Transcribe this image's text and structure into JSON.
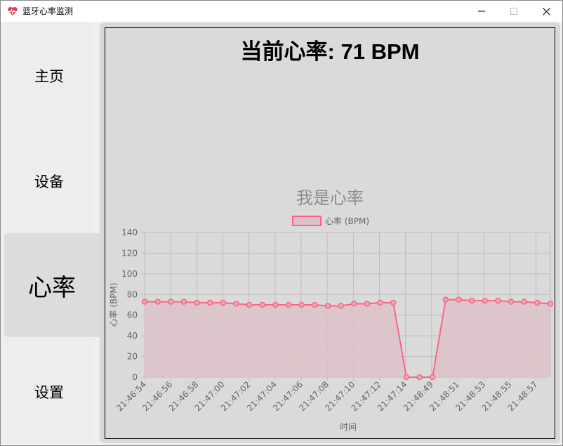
{
  "window": {
    "title": "蓝牙心率监测"
  },
  "sidebar": {
    "items": [
      {
        "label": "主页",
        "active": false
      },
      {
        "label": "设备",
        "active": false
      },
      {
        "label": "心率",
        "active": true
      },
      {
        "label": "设置",
        "active": false
      }
    ]
  },
  "main": {
    "heading_prefix": "当前心率: ",
    "heading_value": "71",
    "heading_unit": " BPM"
  },
  "chart_data": {
    "type": "area",
    "title": "我是心率",
    "xlabel": "时间",
    "ylabel": "心率 (BPM)",
    "legend": [
      "心率 (BPM)"
    ],
    "legend_position": "top",
    "grid": true,
    "ylim": [
      0,
      140
    ],
    "yticks": [
      0,
      20,
      40,
      60,
      80,
      100,
      120,
      140
    ],
    "xtick_labels": [
      "21:46:54",
      "21:46:56",
      "21:46:58",
      "21:47:00",
      "21:47:02",
      "21:47:04",
      "21:47:06",
      "21:47:08",
      "21:47:10",
      "21:47:12",
      "21:47:14",
      "21:48:49",
      "21:48:51",
      "21:48:53",
      "21:48:55",
      "21:48:57"
    ],
    "series": [
      {
        "name": "心率 (BPM)",
        "values": [
          73,
          73,
          73,
          73,
          72,
          72,
          72,
          71,
          70,
          70,
          70,
          70,
          70,
          70,
          69,
          69,
          71,
          71,
          72,
          72,
          0,
          0,
          0,
          75,
          75,
          74,
          74,
          74,
          73,
          73,
          72,
          71
        ]
      }
    ],
    "colors": {
      "line": "#ff6384",
      "fill": "#dcc2c8"
    }
  }
}
